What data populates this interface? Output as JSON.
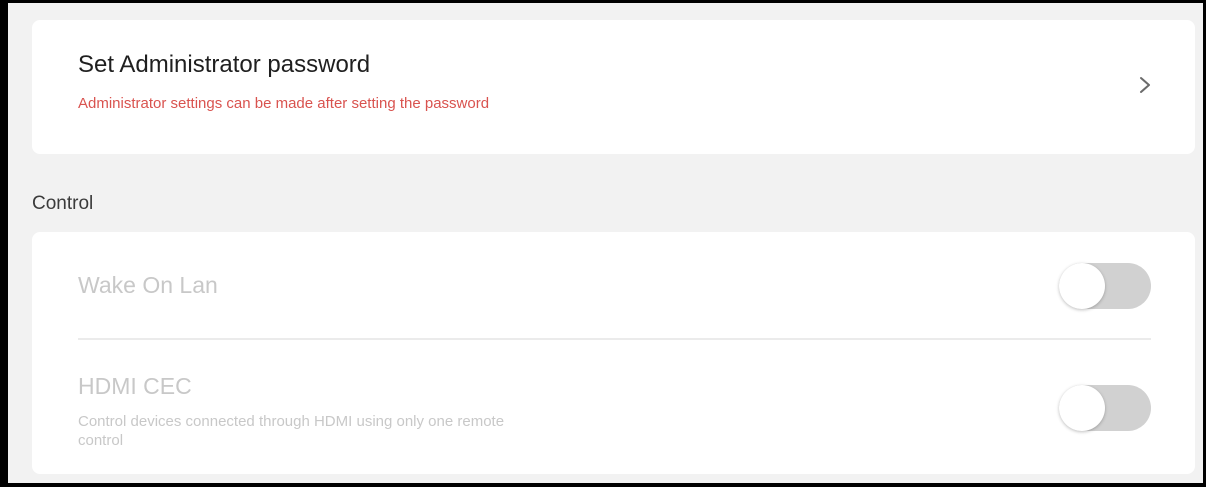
{
  "admin": {
    "title": "Set Administrator password",
    "subtitle": "Administrator settings can be made after setting the password",
    "chevron_icon": "chevron-right-icon",
    "subtitle_color": "#d9534f"
  },
  "control": {
    "section_label": "Control",
    "items": [
      {
        "title": "Wake On Lan",
        "description": "",
        "enabled": false,
        "toggle_on": false
      },
      {
        "title": "HDMI CEC",
        "description": "Control devices connected through HDMI using only one remote control",
        "enabled": false,
        "toggle_on": false
      }
    ]
  }
}
